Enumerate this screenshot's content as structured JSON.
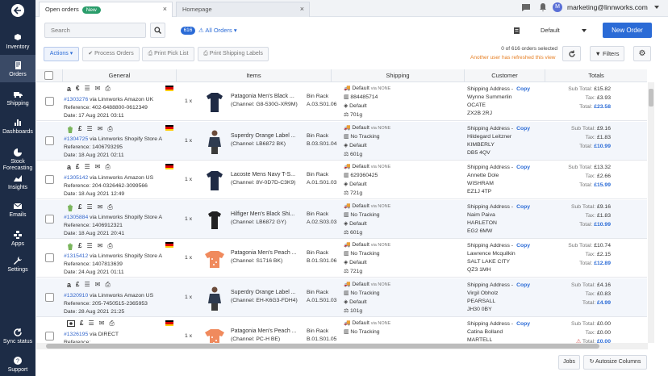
{
  "sidebar": {
    "items": [
      {
        "label": "Inventory",
        "icon": "cubes-icon"
      },
      {
        "label": "Orders",
        "icon": "orders-icon"
      },
      {
        "label": "Shipping",
        "icon": "truck-icon"
      },
      {
        "label": "Dashboards",
        "icon": "bar-chart-icon"
      },
      {
        "label": "Stock Forecasting",
        "icon": "pie-chart-icon"
      },
      {
        "label": "Insights",
        "icon": "area-chart-icon"
      },
      {
        "label": "Emails",
        "icon": "envelope-icon"
      },
      {
        "label": "Apps",
        "icon": "apps-icon"
      },
      {
        "label": "Settings",
        "icon": "wrench-icon"
      },
      {
        "label": "Sync status",
        "icon": "sync-icon"
      },
      {
        "label": "Support",
        "icon": "help-icon"
      }
    ]
  },
  "tabs": [
    {
      "label": "Open orders",
      "badge": "New",
      "close": "×"
    },
    {
      "label": "Homepage",
      "close": "×"
    }
  ],
  "user": {
    "initial": "M",
    "email": "marketing@linnworks.com"
  },
  "toolbar": {
    "search_placeholder": "Search",
    "order_count": "616",
    "all_orders": "All Orders",
    "view": "Default",
    "new_order": "New Order",
    "actions": "Actions",
    "process_orders": "Process Orders",
    "print_pick_list": "Print Pick List",
    "print_shipping_labels": "Print Shipping Labels",
    "selected_text": "0 of 616 orders selected",
    "refresh_warning": "Another user has refreshed this view",
    "filters": "Filters"
  },
  "columns": {
    "general": "General",
    "items": "Items",
    "shipping": "Shipping",
    "customer": "Customer",
    "totals": "Totals"
  },
  "labels": {
    "via": "via",
    "reference": "Reference:",
    "date": "Date:",
    "bin_rack": "Bin Rack",
    "via_none": "via NONE",
    "shipping_address": "Shipping Address -",
    "copy": "Copy",
    "sub_total": "Sub Total:",
    "tax": "Tax:",
    "total": "Total:"
  },
  "orders": [
    {
      "id": "#1303276",
      "source": "Linnworks Amazon UK",
      "reference": "402-6488800-0612349",
      "date": "17 Aug 2021 03:11",
      "qty": "1 x",
      "item_name": "Patagonia Men's Black ...",
      "item_sku": "(Channel: G8-530G-XR9M)",
      "bin": "A.03.S01.06",
      "ship_service": "Default",
      "tracking": "884485714",
      "ship_method": "Default",
      "weight": "701g",
      "cust_name": "Wynne Summerlin",
      "cust_city": "OCATE",
      "cust_post": "ZX2B 2RJ",
      "sub_total": "£15.82",
      "tax": "£3.93",
      "total": "£23.58",
      "currency": "€",
      "channel": "amazon",
      "flag": "de",
      "img": "polo-navy"
    },
    {
      "id": "#1304725",
      "source": "Linnworks Shopify Store A",
      "reference": "1406793295",
      "date": "18 Aug 2021 02:11",
      "qty": "1 x",
      "item_name": "Superdry Orange Label ...",
      "item_sku": "(Channel: LB6872 BK)",
      "bin": "B.03.S01.04",
      "ship_service": "Default",
      "tracking": "No Tracking",
      "ship_method": "Default",
      "weight": "601g",
      "cust_name": "Hildegard Leitzner",
      "cust_city": "KIMBERLY",
      "cust_post": "DB5 4QV",
      "sub_total": "£9.16",
      "tax": "£1.83",
      "total": "£10.99",
      "currency": "£",
      "channel": "shopify",
      "flag": "de",
      "img": "man-dark"
    },
    {
      "id": "#1305142",
      "source": "Linnworks Amazon US",
      "reference": "204-0326462-3099566",
      "date": "18 Aug 2021 12:49",
      "qty": "1 x",
      "item_name": "Lacoste Mens Navy T-S...",
      "item_sku": "(Channel: 8V-0D7D-C3K9)",
      "bin": "A.01.S01.03",
      "ship_service": "Default",
      "tracking": "629360425",
      "ship_method": "Default",
      "weight": "721g",
      "cust_name": "Annette Dole",
      "cust_city": "WISHRAM",
      "cust_post": "EZ1J 4TP",
      "sub_total": "£13.32",
      "tax": "£2.66",
      "total": "£15.99",
      "currency": "£",
      "channel": "amazon",
      "flag": "de",
      "img": "polo-navy"
    },
    {
      "id": "#1305884",
      "source": "Linnworks Shopify Store A",
      "reference": "1406912321",
      "date": "18 Aug 2021 20:41",
      "qty": "1 x",
      "item_name": "Hilfiger Men's Black Shi...",
      "item_sku": "(Channel: LB6872 GY)",
      "bin": "A.02.S03.03",
      "ship_service": "Default",
      "tracking": "No Tracking",
      "ship_method": "Default",
      "weight": "601g",
      "cust_name": "Naim Paiva",
      "cust_city": "HARLETON",
      "cust_post": "EG2 6MW",
      "sub_total": "£9.16",
      "tax": "£1.83",
      "total": "£10.99",
      "currency": "£",
      "channel": "shopify",
      "flag": "",
      "img": "shirt-black"
    },
    {
      "id": "#1315412",
      "source": "Linnworks Shopify Store A",
      "reference": "1407813639",
      "date": "24 Aug 2021 01:11",
      "qty": "1 x",
      "item_name": "Patagonia Men's Peach ...",
      "item_sku": "(Channel: S1716 BK)",
      "bin": "B.01.S01.06",
      "ship_service": "Default",
      "tracking": "No Tracking",
      "ship_method": "Default",
      "weight": "721g",
      "cust_name": "Lawrence Mcquilkin",
      "cust_city": "SALT LAKE CITY",
      "cust_post": "QZ3 1MH",
      "sub_total": "£10.74",
      "tax": "£2.15",
      "total": "£12.89",
      "currency": "£",
      "channel": "shopify",
      "flag": "de",
      "img": "tee-peach"
    },
    {
      "id": "#1320910",
      "source": "Linnworks Amazon US",
      "reference": "205-7450515-2365953",
      "date": "28 Aug 2021 21:25",
      "qty": "1 x",
      "item_name": "Superdry Orange Label ...",
      "item_sku": "(Channel: EH-K6G3-FDH4)",
      "bin": "A.01.S01.03",
      "ship_service": "Default",
      "tracking": "No Tracking",
      "ship_method": "Default",
      "weight": "101g",
      "cust_name": "Virgil Obholz",
      "cust_city": "PEARSALL",
      "cust_post": "JH30 0BY",
      "sub_total": "£4.16",
      "tax": "£0.83",
      "total": "£4.99",
      "currency": "£",
      "channel": "amazon",
      "flag": "",
      "img": "man-dark"
    },
    {
      "id": "#1326195",
      "source": "DIRECT",
      "reference": "",
      "date": "",
      "qty": "1 x",
      "item_name": "Patagonia Men's Peach ...",
      "item_sku": "(Channel: PC-H BE)",
      "bin": "B.01.S01.05",
      "ship_service": "Default",
      "tracking": "No Tracking",
      "ship_method": "",
      "weight": "",
      "cust_name": "Catina Bolland",
      "cust_city": "MARTELL",
      "cust_post": "",
      "sub_total": "£0.00",
      "tax": "£0.00",
      "total": "£0.00",
      "currency": "£",
      "channel": "direct",
      "flag": "de",
      "img": "tee-peach"
    }
  ],
  "footer": {
    "jobs": "Jobs",
    "autosize": "Autosize Columns"
  }
}
